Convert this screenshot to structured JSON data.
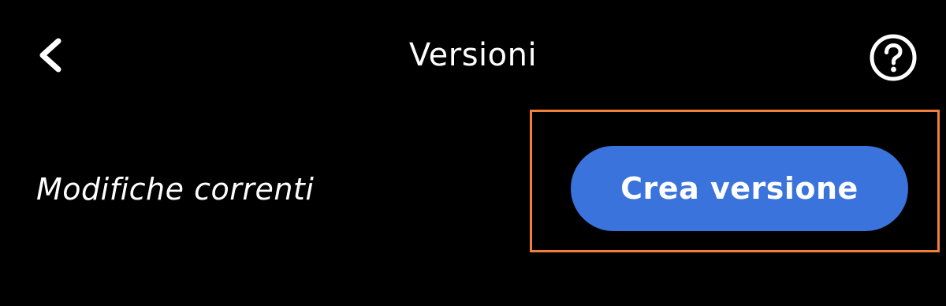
{
  "header": {
    "back_icon": "chevron-left-icon",
    "title": "Versioni",
    "help_icon": "question-circle-icon"
  },
  "current_changes": {
    "label": "Modifiche correnti",
    "create_button_label": "Crea versione"
  },
  "colors": {
    "background": "#000000",
    "text": "#ffffff",
    "button_accent": "#3a73dc",
    "highlight_outline": "#f0803c"
  }
}
